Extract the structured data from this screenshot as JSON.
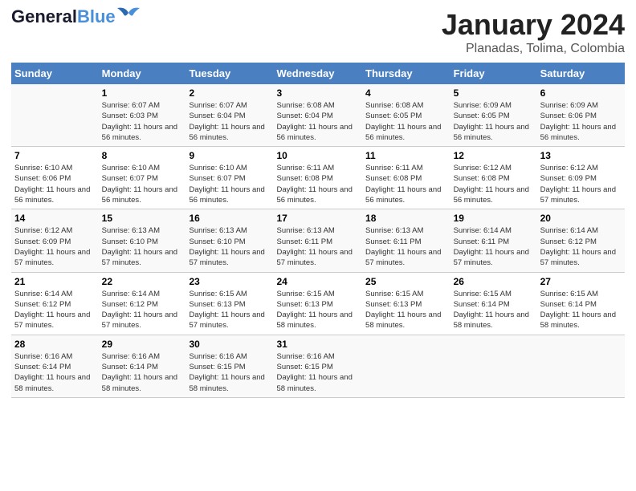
{
  "logo": {
    "line1": "General",
    "line2": "Blue"
  },
  "title": "January 2024",
  "subtitle": "Planadas, Tolima, Colombia",
  "weekdays": [
    "Sunday",
    "Monday",
    "Tuesday",
    "Wednesday",
    "Thursday",
    "Friday",
    "Saturday"
  ],
  "weeks": [
    [
      {
        "num": "",
        "sunrise": "",
        "sunset": "",
        "daylight": ""
      },
      {
        "num": "1",
        "sunrise": "6:07 AM",
        "sunset": "6:03 PM",
        "daylight": "11 hours and 56 minutes."
      },
      {
        "num": "2",
        "sunrise": "6:07 AM",
        "sunset": "6:04 PM",
        "daylight": "11 hours and 56 minutes."
      },
      {
        "num": "3",
        "sunrise": "6:08 AM",
        "sunset": "6:04 PM",
        "daylight": "11 hours and 56 minutes."
      },
      {
        "num": "4",
        "sunrise": "6:08 AM",
        "sunset": "6:05 PM",
        "daylight": "11 hours and 56 minutes."
      },
      {
        "num": "5",
        "sunrise": "6:09 AM",
        "sunset": "6:05 PM",
        "daylight": "11 hours and 56 minutes."
      },
      {
        "num": "6",
        "sunrise": "6:09 AM",
        "sunset": "6:06 PM",
        "daylight": "11 hours and 56 minutes."
      }
    ],
    [
      {
        "num": "7",
        "sunrise": "6:10 AM",
        "sunset": "6:06 PM",
        "daylight": "11 hours and 56 minutes."
      },
      {
        "num": "8",
        "sunrise": "6:10 AM",
        "sunset": "6:07 PM",
        "daylight": "11 hours and 56 minutes."
      },
      {
        "num": "9",
        "sunrise": "6:10 AM",
        "sunset": "6:07 PM",
        "daylight": "11 hours and 56 minutes."
      },
      {
        "num": "10",
        "sunrise": "6:11 AM",
        "sunset": "6:08 PM",
        "daylight": "11 hours and 56 minutes."
      },
      {
        "num": "11",
        "sunrise": "6:11 AM",
        "sunset": "6:08 PM",
        "daylight": "11 hours and 56 minutes."
      },
      {
        "num": "12",
        "sunrise": "6:12 AM",
        "sunset": "6:08 PM",
        "daylight": "11 hours and 56 minutes."
      },
      {
        "num": "13",
        "sunrise": "6:12 AM",
        "sunset": "6:09 PM",
        "daylight": "11 hours and 57 minutes."
      }
    ],
    [
      {
        "num": "14",
        "sunrise": "6:12 AM",
        "sunset": "6:09 PM",
        "daylight": "11 hours and 57 minutes."
      },
      {
        "num": "15",
        "sunrise": "6:13 AM",
        "sunset": "6:10 PM",
        "daylight": "11 hours and 57 minutes."
      },
      {
        "num": "16",
        "sunrise": "6:13 AM",
        "sunset": "6:10 PM",
        "daylight": "11 hours and 57 minutes."
      },
      {
        "num": "17",
        "sunrise": "6:13 AM",
        "sunset": "6:11 PM",
        "daylight": "11 hours and 57 minutes."
      },
      {
        "num": "18",
        "sunrise": "6:13 AM",
        "sunset": "6:11 PM",
        "daylight": "11 hours and 57 minutes."
      },
      {
        "num": "19",
        "sunrise": "6:14 AM",
        "sunset": "6:11 PM",
        "daylight": "11 hours and 57 minutes."
      },
      {
        "num": "20",
        "sunrise": "6:14 AM",
        "sunset": "6:12 PM",
        "daylight": "11 hours and 57 minutes."
      }
    ],
    [
      {
        "num": "21",
        "sunrise": "6:14 AM",
        "sunset": "6:12 PM",
        "daylight": "11 hours and 57 minutes."
      },
      {
        "num": "22",
        "sunrise": "6:14 AM",
        "sunset": "6:12 PM",
        "daylight": "11 hours and 57 minutes."
      },
      {
        "num": "23",
        "sunrise": "6:15 AM",
        "sunset": "6:13 PM",
        "daylight": "11 hours and 57 minutes."
      },
      {
        "num": "24",
        "sunrise": "6:15 AM",
        "sunset": "6:13 PM",
        "daylight": "11 hours and 58 minutes."
      },
      {
        "num": "25",
        "sunrise": "6:15 AM",
        "sunset": "6:13 PM",
        "daylight": "11 hours and 58 minutes."
      },
      {
        "num": "26",
        "sunrise": "6:15 AM",
        "sunset": "6:14 PM",
        "daylight": "11 hours and 58 minutes."
      },
      {
        "num": "27",
        "sunrise": "6:15 AM",
        "sunset": "6:14 PM",
        "daylight": "11 hours and 58 minutes."
      }
    ],
    [
      {
        "num": "28",
        "sunrise": "6:16 AM",
        "sunset": "6:14 PM",
        "daylight": "11 hours and 58 minutes."
      },
      {
        "num": "29",
        "sunrise": "6:16 AM",
        "sunset": "6:14 PM",
        "daylight": "11 hours and 58 minutes."
      },
      {
        "num": "30",
        "sunrise": "6:16 AM",
        "sunset": "6:15 PM",
        "daylight": "11 hours and 58 minutes."
      },
      {
        "num": "31",
        "sunrise": "6:16 AM",
        "sunset": "6:15 PM",
        "daylight": "11 hours and 58 minutes."
      },
      {
        "num": "",
        "sunrise": "",
        "sunset": "",
        "daylight": ""
      },
      {
        "num": "",
        "sunrise": "",
        "sunset": "",
        "daylight": ""
      },
      {
        "num": "",
        "sunrise": "",
        "sunset": "",
        "daylight": ""
      }
    ]
  ]
}
